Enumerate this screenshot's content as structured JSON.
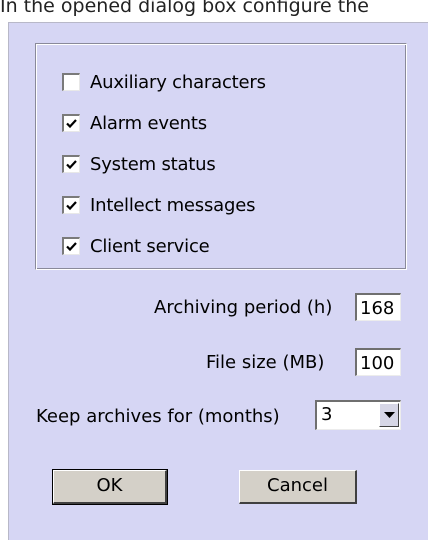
{
  "caption": "In the opened dialog box configure the",
  "checkboxes": [
    {
      "label": "Auxiliary characters",
      "checked": false
    },
    {
      "label": "Alarm events",
      "checked": true
    },
    {
      "label": "System status",
      "checked": true
    },
    {
      "label": "Intellect messages",
      "checked": true
    },
    {
      "label": "Client service",
      "checked": true
    }
  ],
  "archiving_period": {
    "label": "Archiving period (h)",
    "value": "168"
  },
  "file_size": {
    "label": "File size (MB)",
    "value": "100"
  },
  "keep_archives": {
    "label": "Keep archives for (months)",
    "value": "3"
  },
  "buttons": {
    "ok": "OK",
    "cancel": "Cancel"
  },
  "colors": {
    "dialog_bg": "#d6d6f4",
    "button_bg": "#d4d0c8"
  }
}
